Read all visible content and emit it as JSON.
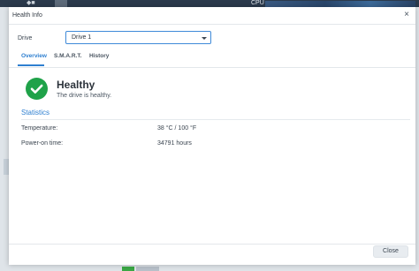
{
  "background": {
    "cpu_label": "CPU",
    "left_icons": "◆■"
  },
  "dialog": {
    "title": "Health Info",
    "close_glyph": "×"
  },
  "drive": {
    "label": "Drive",
    "selected": "Drive 1"
  },
  "tabs": [
    {
      "label": "Overview",
      "active": true
    },
    {
      "label": "S.M.A.R.T.",
      "active": false
    },
    {
      "label": "History",
      "active": false
    }
  ],
  "status": {
    "icon": "check-circle-icon",
    "title": "Healthy",
    "description": "The drive is healthy.",
    "color": "#1fa249"
  },
  "statistics": {
    "title": "Statistics",
    "rows": [
      {
        "label": "Temperature:",
        "value": "38 °C / 100 °F"
      },
      {
        "label": "Power-on time:",
        "value": "34791 hours"
      }
    ]
  },
  "footer": {
    "close_label": "Close"
  },
  "colors": {
    "accent": "#2e7fd0",
    "success": "#1fa249"
  }
}
